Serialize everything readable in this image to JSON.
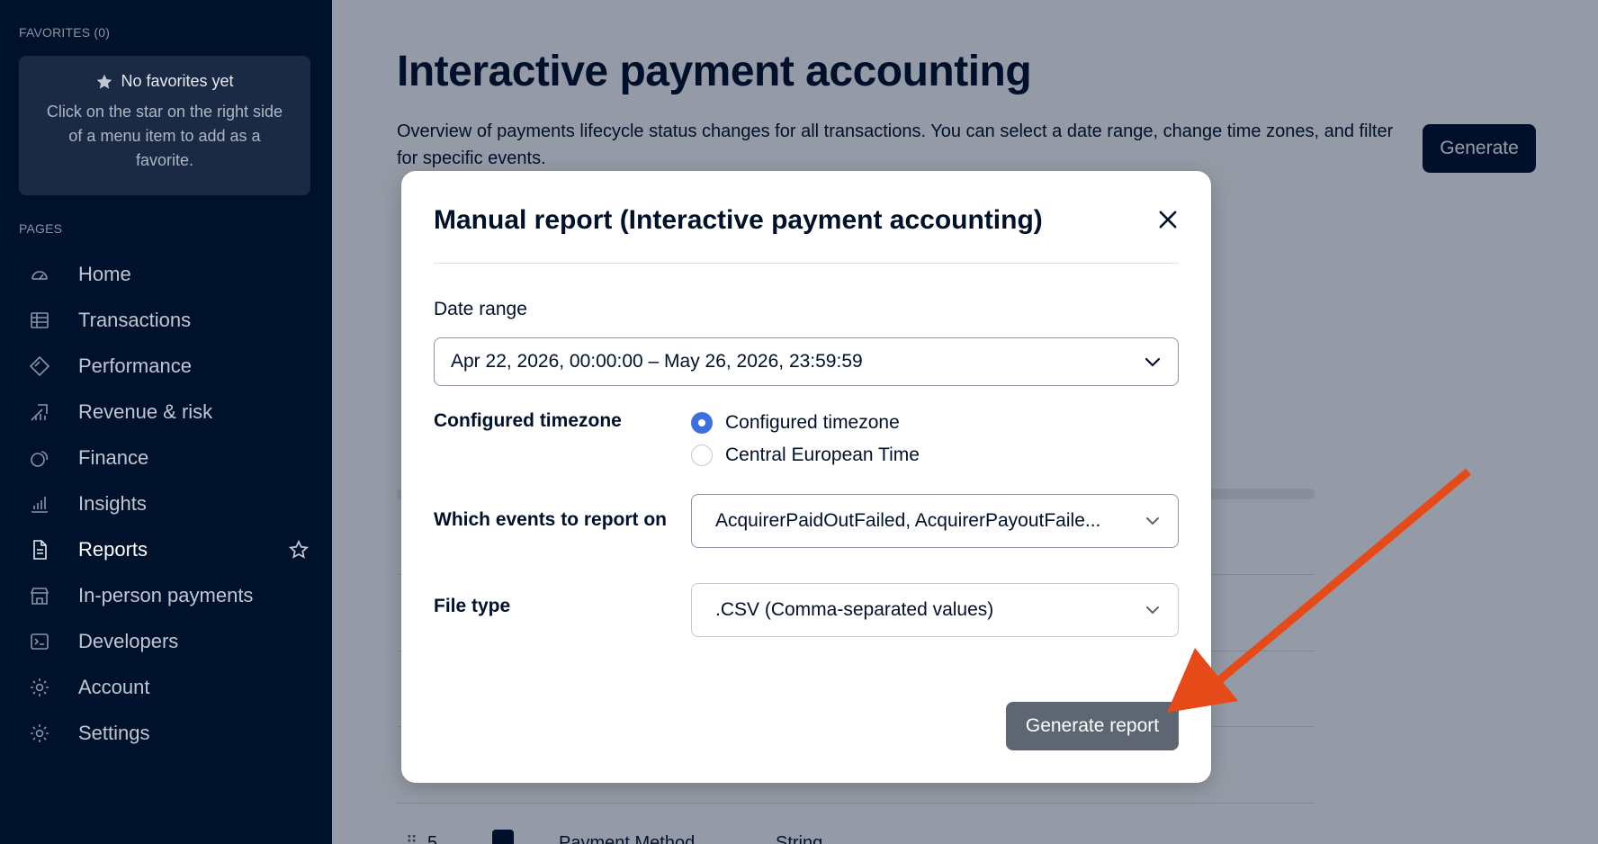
{
  "sidebar": {
    "favorites_label": "FAVORITES (0)",
    "favorites_empty_title": "No favorites yet",
    "favorites_empty_text": "Click on the star on the right side of a menu item to add as a favorite.",
    "pages_label": "PAGES",
    "items": [
      {
        "label": "Home",
        "icon": "gauge-icon"
      },
      {
        "label": "Transactions",
        "icon": "table-icon"
      },
      {
        "label": "Performance",
        "icon": "diamond-icon"
      },
      {
        "label": "Revenue & risk",
        "icon": "chart-arrow-icon"
      },
      {
        "label": "Finance",
        "icon": "coins-icon"
      },
      {
        "label": "Insights",
        "icon": "bar-chart-icon"
      },
      {
        "label": "Reports",
        "icon": "document-icon",
        "active": true
      },
      {
        "label": "In-person payments",
        "icon": "store-icon"
      },
      {
        "label": "Developers",
        "icon": "terminal-icon"
      },
      {
        "label": "Account",
        "icon": "gear-icon"
      },
      {
        "label": "Settings",
        "icon": "gear-icon"
      }
    ]
  },
  "main": {
    "title": "Interactive payment accounting",
    "description": "Overview of payments lifecycle status changes for all transactions. You can select a date range, change time zones, and filter for specific events.",
    "generate_label": "Generate",
    "background_row": {
      "index": "5",
      "name": "Payment Method",
      "type": "String"
    }
  },
  "modal": {
    "title": "Manual report (Interactive payment accounting)",
    "date_range_label": "Date range",
    "date_range_value": "Apr 22, 2026, 00:00:00 – May 26, 2026, 23:59:59",
    "timezone_label": "Configured timezone",
    "timezone_options": [
      "Configured timezone",
      "Central European Time"
    ],
    "timezone_selected": "Configured timezone",
    "events_label": "Which events to report on",
    "events_value": "AcquirerPaidOutFailed, AcquirerPayoutFaile...",
    "file_type_label": "File type",
    "file_type_value": ".CSV (Comma-separated values)",
    "generate_report_label": "Generate report"
  },
  "colors": {
    "sidebar_bg": "#00112c",
    "primary": "#00112c",
    "radio_selected": "#3b6fe0",
    "annotation_arrow": "#e64a19",
    "generate_report_bg": "#5e6674"
  }
}
